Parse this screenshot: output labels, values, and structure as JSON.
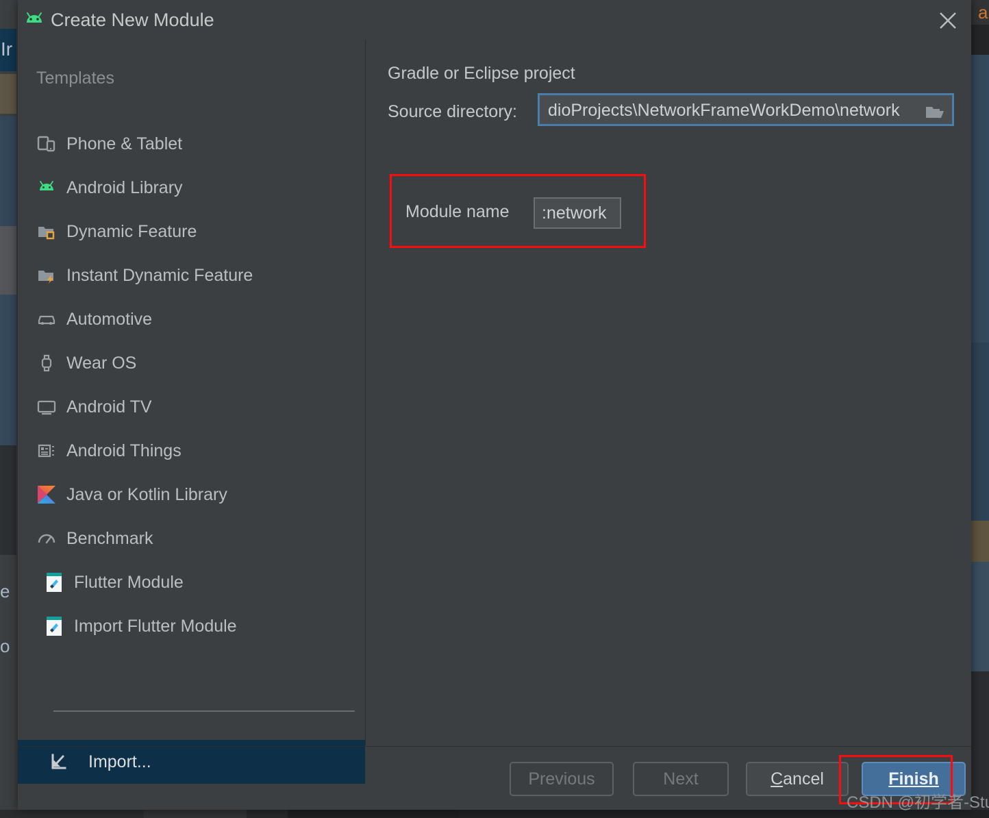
{
  "window": {
    "title": "Create New Module",
    "app_icon": "android-icon",
    "close_icon": "close-icon"
  },
  "sidebar": {
    "header": "Templates",
    "items": [
      {
        "label": "Phone & Tablet",
        "icon": "phone-tablet-icon"
      },
      {
        "label": "Android Library",
        "icon": "android-icon"
      },
      {
        "label": "Dynamic Feature",
        "icon": "dynamic-feature-icon"
      },
      {
        "label": "Instant Dynamic Feature",
        "icon": "instant-dynamic-feature-icon"
      },
      {
        "label": "Automotive",
        "icon": "car-icon"
      },
      {
        "label": "Wear OS",
        "icon": "watch-icon"
      },
      {
        "label": "Android TV",
        "icon": "tv-icon"
      },
      {
        "label": "Android Things",
        "icon": "things-icon"
      },
      {
        "label": "Java or Kotlin Library",
        "icon": "kotlin-icon"
      },
      {
        "label": "Benchmark",
        "icon": "benchmark-icon"
      },
      {
        "label": "Flutter Module",
        "icon": "flutter-icon"
      },
      {
        "label": "Import Flutter Module",
        "icon": "flutter-icon"
      }
    ],
    "import_item": {
      "label": "Import...",
      "icon": "import-arrow-icon",
      "selected": true
    }
  },
  "main": {
    "section_title": "Gradle or Eclipse project",
    "source_directory": {
      "label": "Source directory:",
      "value": "dioProjects\\NetworkFrameWorkDemo\\network",
      "browse_icon": "folder-icon"
    },
    "module_name": {
      "label": "Module name",
      "value": ":network"
    }
  },
  "footer": {
    "previous": "Previous",
    "next": "Next",
    "cancel_prefix": "C",
    "cancel_rest": "ancel",
    "finish_prefix": "F",
    "finish_rest": "inish"
  },
  "watermark": "CSDN @初学者-Study",
  "background": {
    "left_text": "Ir",
    "left_text_e": "e",
    "left_text_o": "o",
    "right_text": "a"
  },
  "colors": {
    "dialog_bg": "#3c3f41",
    "selection_navy": "#0d3048",
    "accent_blue": "#456f9b",
    "focus_border": "#4a7ead",
    "annotation_red": "#fb0d0d",
    "android_green": "#3ddc84",
    "text_primary": "#bcbfc1",
    "text_dim": "#8c8f91"
  }
}
